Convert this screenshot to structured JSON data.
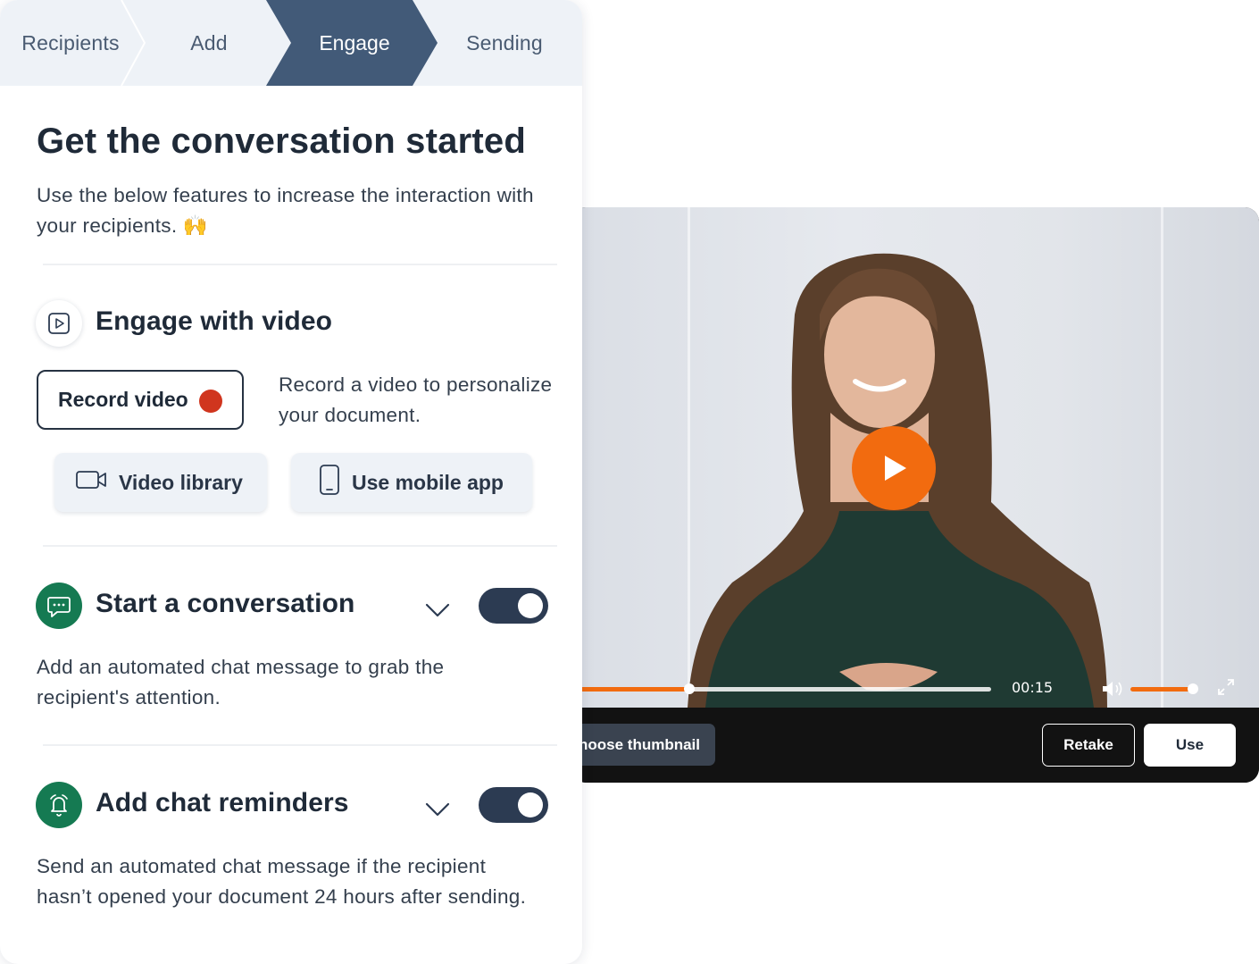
{
  "stepper": {
    "steps": [
      {
        "label": "Recipients"
      },
      {
        "label": "Add"
      },
      {
        "label": "Engage",
        "active": true
      },
      {
        "label": "Sending"
      }
    ]
  },
  "main": {
    "title": "Get the conversation started",
    "subtitle": "Use the below features to increase the interaction with your recipients. 🙌"
  },
  "video_section": {
    "title": "Engage with video",
    "icon": "play-square-icon",
    "record_label": "Record video",
    "record_description": "Record a video to personalize your document.",
    "library_label": "Video library",
    "library_icon": "video-camera-icon",
    "mobile_label": "Use mobile app",
    "mobile_icon": "smartphone-icon"
  },
  "conversation_section": {
    "title": "Start a conversation",
    "icon": "chat-bubble-icon",
    "enabled": true,
    "description": "Add an automated chat message to grab the recipient's attention."
  },
  "reminders_section": {
    "title": "Add chat reminders",
    "icon": "bell-icon",
    "enabled": true,
    "description": "Send an automated chat message if the recipient hasn’t opened your document 24 hours after sending."
  },
  "player": {
    "time": "00:15",
    "progress_fraction": 0.28,
    "volume_fraction": 0.95,
    "choose_thumbnail_label": "hoose thumbnail",
    "retake_label": "Retake",
    "use_label": "Use",
    "controls": [
      "play-icon",
      "volume-icon",
      "fullscreen-icon"
    ]
  },
  "colors": {
    "accent": "#f26b0f",
    "step_active": "#425a78",
    "toggle_on": "#2c3b52",
    "icon_green": "#157a52",
    "record_dot": "#d0351e"
  }
}
